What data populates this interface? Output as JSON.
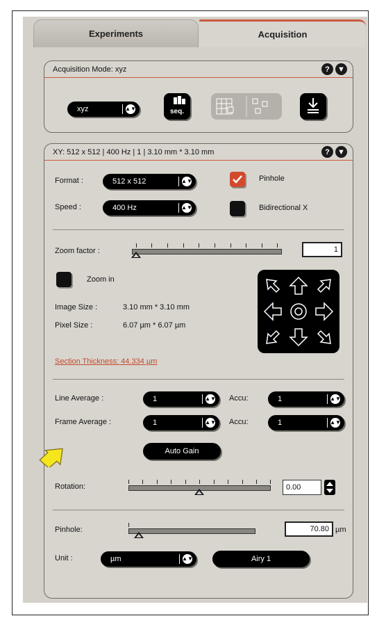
{
  "tabs": [
    {
      "label": "Experiments",
      "active": false
    },
    {
      "label": "Acquisition",
      "active": true
    }
  ],
  "acq_mode": {
    "title": "Acquisition Mode: xyz",
    "mode_value": "xyz"
  },
  "xy": {
    "title": "XY:  512 x 512 | 400 Hz | 1 | 3.10 mm * 3.10 mm",
    "format_label": "Format :",
    "format_value": "512 x 512",
    "speed_label": "Speed :",
    "speed_value": "400 Hz",
    "pinhole_check_label": "Pinhole",
    "pinhole_checked": true,
    "bidirectional_label": "Bidirectional X",
    "bidirectional_checked": false,
    "zoom_label": "Zoom factor :",
    "zoom_value": "1",
    "zoom_in_label": "Zoom in",
    "image_size_label": "Image Size :",
    "image_size_value": "3.10 mm * 3.10 mm",
    "pixel_size_label": "Pixel Size :",
    "pixel_size_value": "6.07 µm * 6.07 µm",
    "section_thickness": "Section Thickness: 44.334 µm",
    "line_avg_label": "Line Average :",
    "line_avg_value": "1",
    "accu_label": "Accu:",
    "line_accu_value": "1",
    "frame_avg_label": "Frame Average :",
    "frame_avg_value": "1",
    "frame_accu_value": "1",
    "auto_gain_label": "Auto Gain",
    "rotation_label": "Rotation:",
    "rotation_value": "0.00",
    "pinhole_label": "Pinhole:",
    "pinhole_value": "70.80",
    "pinhole_unit": "µm",
    "unit_label": "Unit :",
    "unit_value": "µm",
    "airy_label": "Airy 1"
  },
  "colors": {
    "accent": "#c9583c",
    "panel_bg": "#d8d5cf",
    "pointer_arrow": "#f5e61e"
  }
}
